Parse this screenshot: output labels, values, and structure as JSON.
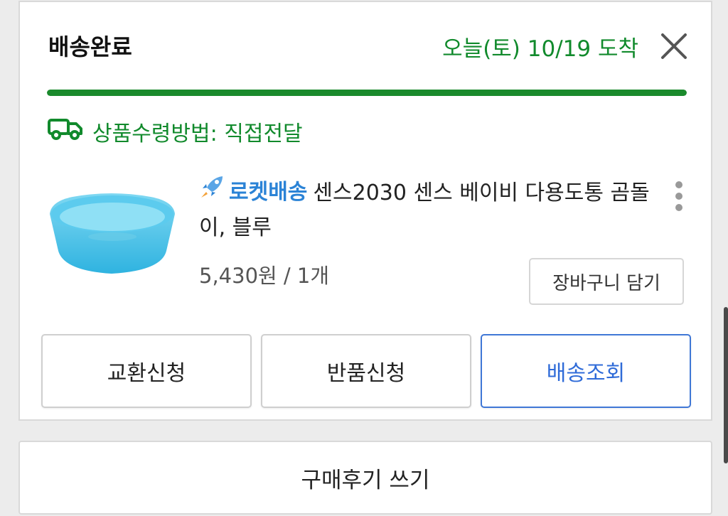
{
  "order": {
    "status": "배송완료",
    "arrival_text": "오늘(토) 10/19 도착",
    "progress_fraction": 1.0,
    "receive_method": "상품수령방법: 직접전달"
  },
  "product": {
    "badge": "로켓배송",
    "name": "센스2030 센스 베이비 다용도통 곰돌이, 블루",
    "price_qty": "5,430원 / 1개",
    "cart_button": "장바구니 담기"
  },
  "actions": {
    "exchange": "교환신청",
    "return": "반품신청",
    "tracking": "배송조회"
  },
  "review": {
    "label": "구매후기 쓰기"
  },
  "colors": {
    "status_green": "#118a2c",
    "primary_blue": "#2f6bd8",
    "rocket_blue": "#2b83d6"
  },
  "icons": [
    "close-icon",
    "truck-icon",
    "rocket-icon",
    "more-vertical-icon"
  ]
}
